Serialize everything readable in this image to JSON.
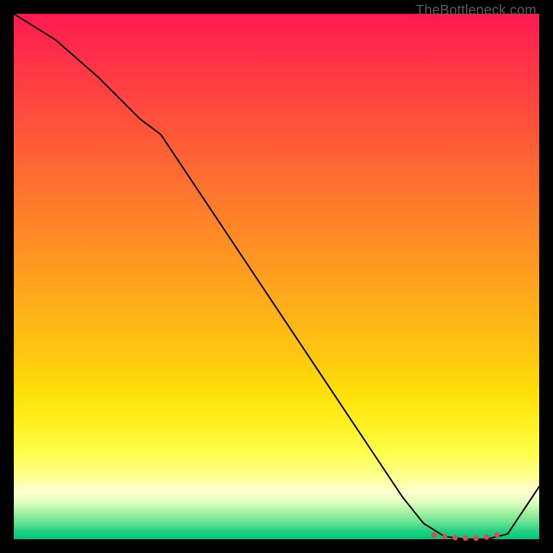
{
  "watermark": "TheBottleneck.com",
  "chart_data": {
    "type": "line",
    "title": "",
    "xlabel": "",
    "ylabel": "",
    "xlim": [
      0,
      100
    ],
    "ylim": [
      0,
      100
    ],
    "grid": false,
    "series": [
      {
        "name": "bottleneck-curve",
        "x": [
          0,
          8,
          16,
          24,
          28,
          36,
          44,
          52,
          60,
          68,
          74,
          78,
          82,
          86,
          90,
          94,
          100
        ],
        "values": [
          100,
          95,
          88,
          80,
          77,
          65,
          53,
          41,
          29,
          17,
          8,
          3,
          0.5,
          0,
          0,
          1,
          10
        ]
      }
    ],
    "markers": {
      "name": "optimal-range",
      "x": [
        80,
        82,
        84,
        86,
        88,
        90,
        92
      ],
      "values": [
        0.8,
        0.5,
        0.3,
        0.2,
        0.2,
        0.4,
        0.8
      ]
    },
    "colors": {
      "line": "#000000",
      "markers": "#d94a55",
      "gradient_top": "#ff1a50",
      "gradient_bottom": "#00c878"
    }
  }
}
